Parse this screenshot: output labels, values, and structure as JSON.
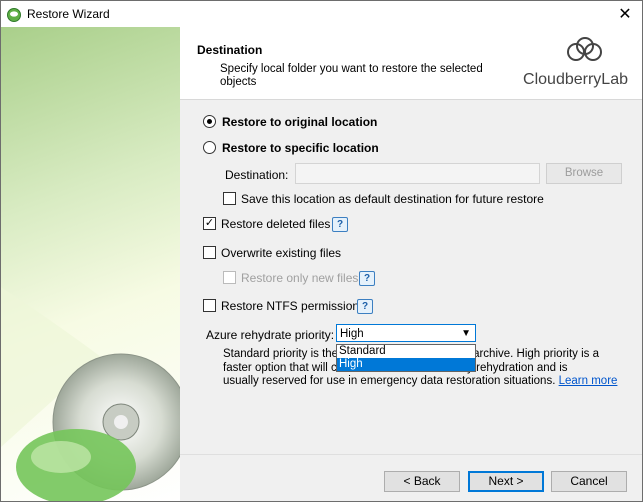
{
  "window": {
    "title": "Restore Wizard",
    "close_glyph": "✕"
  },
  "header": {
    "title": "Destination",
    "subtitle": "Specify local folder you want to restore the selected objects",
    "logo_text": "CloudberryLab"
  },
  "options": {
    "original_location": "Restore to original location",
    "specific_location": "Restore to specific location",
    "destination_label": "Destination:",
    "destination_value": "",
    "browse_label": "Browse",
    "save_default": "Save this location as default destination for future restore",
    "restore_deleted": "Restore deleted files",
    "overwrite_existing": "Overwrite existing files",
    "restore_only_new": "Restore only new files",
    "restore_ntfs": "Restore NTFS permissions",
    "help_glyph": "?"
  },
  "rehydrate": {
    "label": "Azure rehydrate priority:",
    "selected": "High",
    "options": [
      "Standard",
      "High"
    ],
    "desc_start": "Standard priority is the",
    "desc_start_tail": "for archive. High priority is a",
    "desc_line2_a": "faster option that will c",
    "desc_line2_b": "ority rehydration and is",
    "desc_line3": "usually reserved for use in emergency data restoration situations.",
    "learn_more": "Learn more"
  },
  "footer": {
    "back": "< Back",
    "next": "Next >",
    "cancel": "Cancel"
  }
}
